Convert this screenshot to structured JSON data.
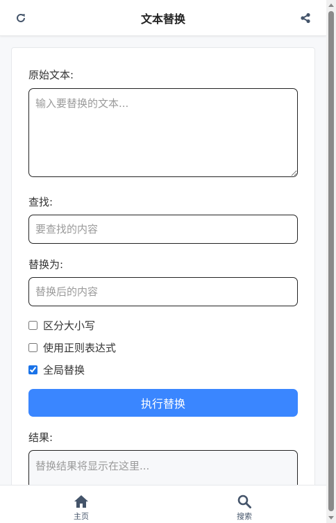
{
  "header": {
    "title": "文本替换",
    "left_icon": "refresh-icon",
    "right_icon": "share-icon"
  },
  "form": {
    "original_label": "原始文本:",
    "original_placeholder": "输入要替换的文本...",
    "find_label": "查找:",
    "find_placeholder": "要查找的内容",
    "replace_label": "替换为:",
    "replace_placeholder": "替换后的内容",
    "options": [
      {
        "label": "区分大小写",
        "checked": false
      },
      {
        "label": "使用正则表达式",
        "checked": false
      },
      {
        "label": "全局替换",
        "checked": true
      }
    ],
    "execute_label": "执行替换",
    "result_label": "结果:",
    "result_placeholder": "替换结果将显示在这里..."
  },
  "bottom_nav": {
    "items": [
      {
        "label": "主页",
        "icon": "home-icon"
      },
      {
        "label": "搜索",
        "icon": "search-icon"
      }
    ]
  },
  "colors": {
    "accent": "#3a86ff",
    "nav_icon": "#44546a",
    "checkbox": "#1a73e8"
  }
}
